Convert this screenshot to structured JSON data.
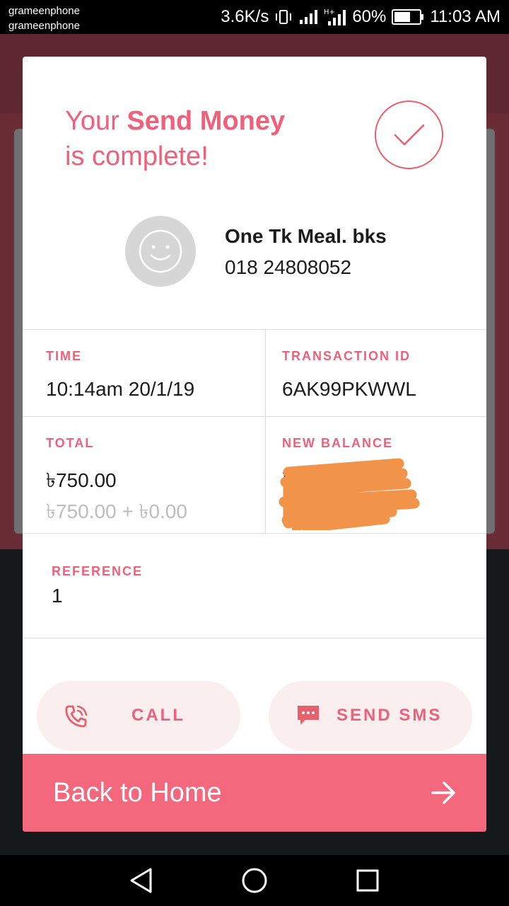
{
  "status_bar": {
    "carrier_1": "grameenphone",
    "carrier_2": "grameenphone",
    "net_speed": "3.6K/s",
    "battery": "60%",
    "time": "11:03 AM"
  },
  "dialog": {
    "headline_part1": "Your ",
    "headline_bold": "Send Money",
    "headline_part2": "is complete!",
    "recipient": {
      "name": "One Tk Meal. bks",
      "number": "018 24808052"
    },
    "details": {
      "time_label": "TIME",
      "time_value": "10:14am 20/1/19",
      "txid_label": "TRANSACTION ID",
      "txid_value": "6AK99PKWWL",
      "total_label": "TOTAL",
      "total_value": "৳750.00",
      "total_breakdown": "৳750.00 + ৳0.00",
      "balance_label": "NEW BALANCE",
      "balance_value": "৳"
    },
    "reference": {
      "label": "REFERENCE",
      "value": "1"
    },
    "call_label": "CALL",
    "sms_label": "SEND SMS",
    "home_label": "Back to Home"
  },
  "icons": {
    "check": "check-icon",
    "avatar": "smiley-icon",
    "call": "phone-icon",
    "sms": "chat-icon",
    "arrow": "arrow-right-icon"
  },
  "colors": {
    "accent": "#f0607a",
    "home_bar": "#f4687d",
    "button_bg": "#fbeeee"
  }
}
